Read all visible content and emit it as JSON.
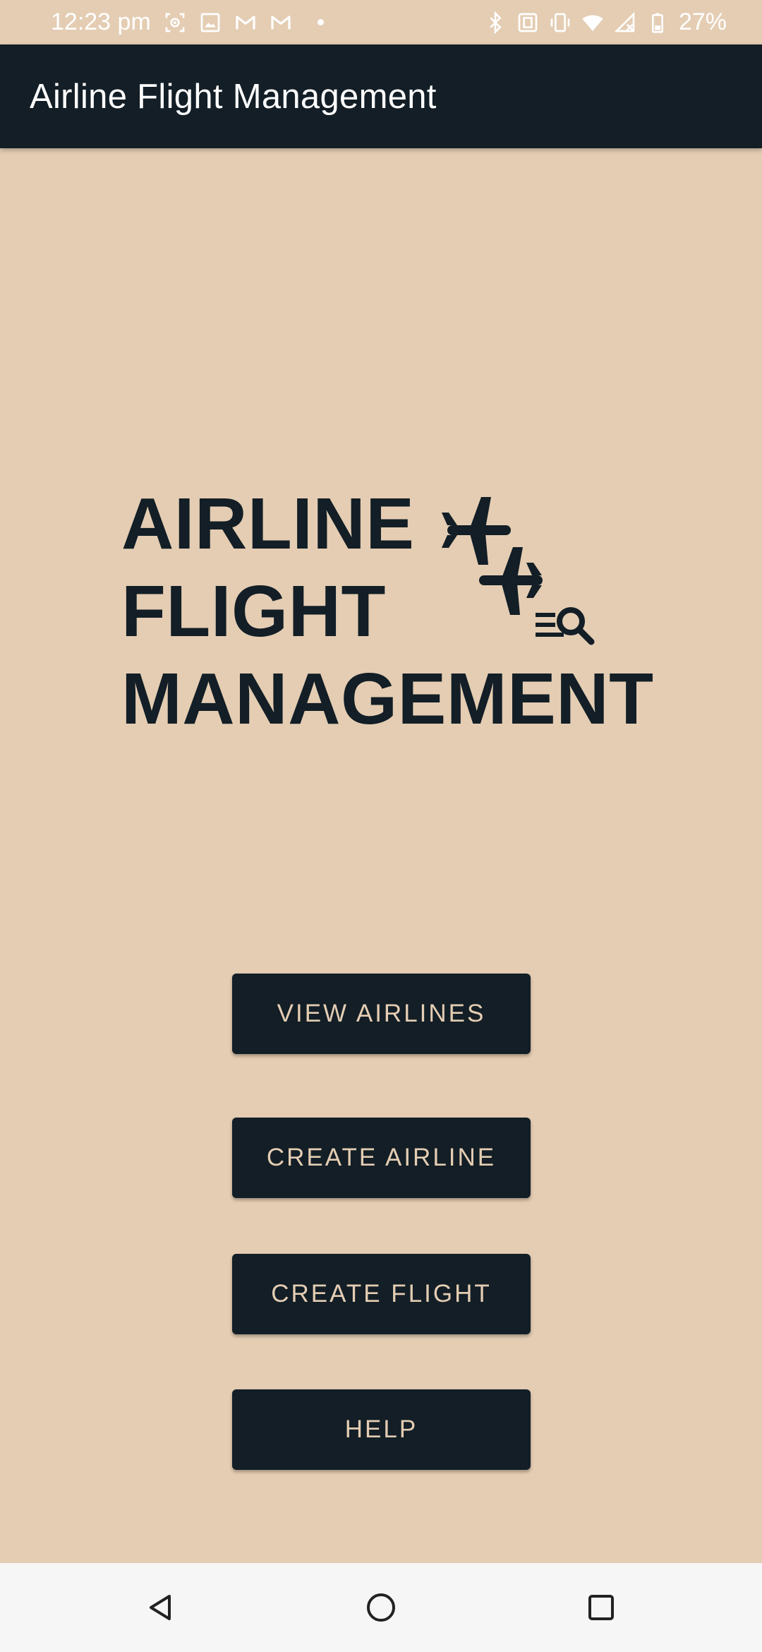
{
  "status_bar": {
    "time": "12:23 pm",
    "battery": "27%",
    "left_icons": [
      "screen-record-icon",
      "image-icon",
      "gmail-icon",
      "gmail-icon",
      "notification-dot-icon"
    ],
    "right_icons": [
      "bluetooth-icon",
      "nfc-icon",
      "vibrate-icon",
      "wifi-icon",
      "no-signal-icon",
      "battery-icon"
    ]
  },
  "app_bar": {
    "title": "Airline Flight Management"
  },
  "logo": {
    "lines": [
      "AIRLINE",
      "FLIGHT",
      "MANAGEMENT"
    ],
    "icon": "airplanes-search-icon"
  },
  "buttons": {
    "view_airlines": "VIEW AIRLINES",
    "create_airline": "CREATE AIRLINE",
    "create_flight": "CREATE FLIGHT",
    "help": "HELP"
  },
  "nav_bar": {
    "icons": [
      "back-icon",
      "home-icon",
      "recent-apps-icon"
    ]
  },
  "colors": {
    "background": "#e4cdb3",
    "primary_dark": "#131e26",
    "button_text": "#e4cdb3",
    "nav_bar": "#f6f6f6"
  }
}
